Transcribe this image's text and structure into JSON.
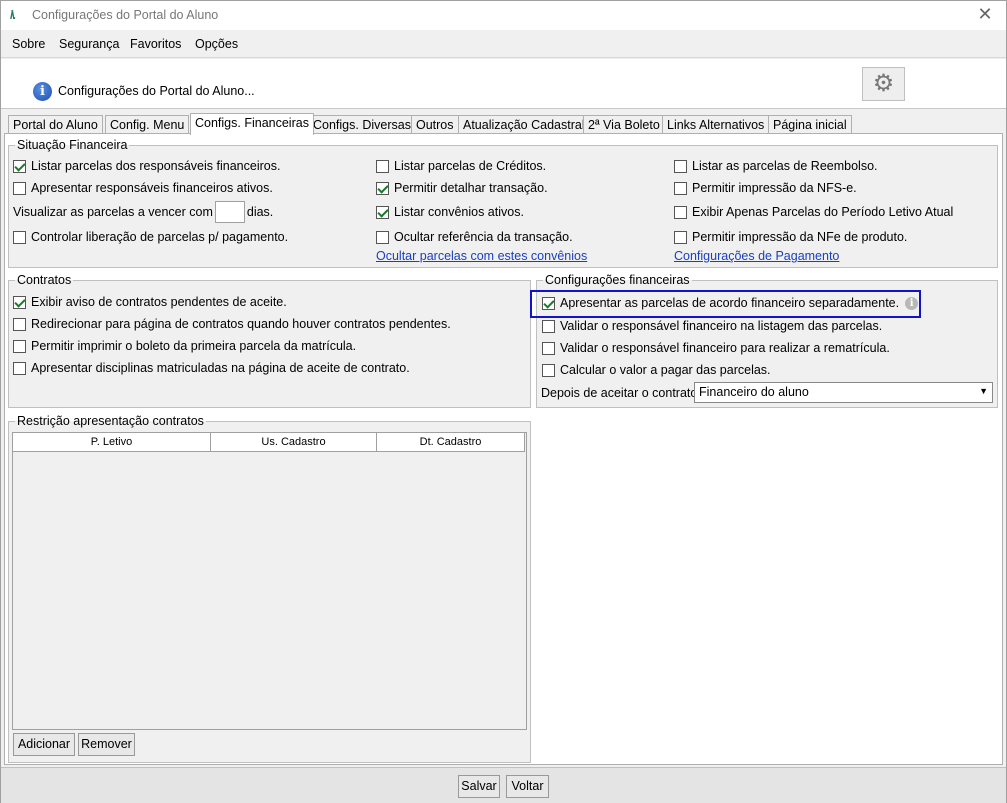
{
  "window": {
    "logo": "/\\.",
    "title": "Configurações do Portal do Aluno",
    "close": "✕"
  },
  "menu": [
    "Sobre",
    "Segurança",
    "Favoritos",
    "Opções"
  ],
  "header": {
    "text": "Configurações do Portal do Aluno...",
    "info_icon": "i",
    "gear_icon": "⚙"
  },
  "tabs": [
    "Portal do Aluno",
    "Config. Menu",
    "Configs. Financeiras",
    "Configs. Diversas",
    "Outros",
    "Atualização Cadastral",
    "2ª Via Boleto",
    "Links Alternativos",
    "Página inicial"
  ],
  "active_tab": "Configs. Financeiras",
  "situacao": {
    "legend": "Situação Financeira",
    "col1": [
      {
        "label": "Listar parcelas dos responsáveis financeiros.",
        "checked": true
      },
      {
        "label": "Apresentar responsáveis financeiros ativos.",
        "checked": false
      },
      {
        "label": "Controlar liberação de parcelas p/ pagamento.",
        "checked": false
      }
    ],
    "vencer_prefix": "Visualizar as parcelas a vencer com",
    "vencer_value": "",
    "vencer_suffix": "dias.",
    "col2": [
      {
        "label": "Listar parcelas de Créditos.",
        "checked": false
      },
      {
        "label": "Permitir detalhar transação.",
        "checked": true
      },
      {
        "label": "Listar convênios ativos.",
        "checked": true
      },
      {
        "label": "Ocultar referência da transação.",
        "checked": false
      }
    ],
    "link2": "Ocultar parcelas com estes convênios",
    "col3": [
      {
        "label": "Listar as parcelas de Reembolso.",
        "checked": false
      },
      {
        "label": "Permitir impressão da NFS-e.",
        "checked": false
      },
      {
        "label": "Exibir Apenas Parcelas do Período Letivo Atual",
        "checked": false
      },
      {
        "label": "Permitir impressão da NFe de produto.",
        "checked": false
      }
    ],
    "link3": "Configurações de Pagamento"
  },
  "contratos": {
    "legend": "Contratos",
    "items": [
      {
        "label": "Exibir aviso de contratos pendentes de aceite.",
        "checked": true
      },
      {
        "label": "Redirecionar para página de contratos quando houver contratos pendentes.",
        "checked": false
      },
      {
        "label": "Permitir imprimir o boleto da primeira parcela da matrícula.",
        "checked": false
      },
      {
        "label": "Apresentar disciplinas matriculadas na página de aceite de contrato.",
        "checked": false
      }
    ]
  },
  "config_fin": {
    "legend": "Configurações financeiras",
    "items": [
      {
        "label": "Apresentar as parcelas de acordo financeiro separadamente.",
        "checked": true
      },
      {
        "label": "Validar o responsável financeiro na listagem das parcelas.",
        "checked": false
      },
      {
        "label": "Validar o responsável financeiro para realizar a rematrícula.",
        "checked": false
      },
      {
        "label": "Calcular o valor a pagar das parcelas.",
        "checked": false
      }
    ],
    "info_glyph": "i",
    "select_label": "Depois de aceitar o contrato:",
    "select_value": "Financeiro do aluno",
    "select_arrow": "▼"
  },
  "restricao": {
    "legend": "Restrição apresentação contratos",
    "columns": [
      "P. Letivo",
      "Us. Cadastro",
      "Dt. Cadastro"
    ],
    "rows": [],
    "add_label": "Adicionar",
    "remove_label": "Remover"
  },
  "footer": {
    "save_label": "Salvar",
    "back_label": "Voltar"
  },
  "colors": {
    "highlight_border": "#1212c8",
    "link": "#1a3fbf",
    "check": "#1a7a2a"
  }
}
